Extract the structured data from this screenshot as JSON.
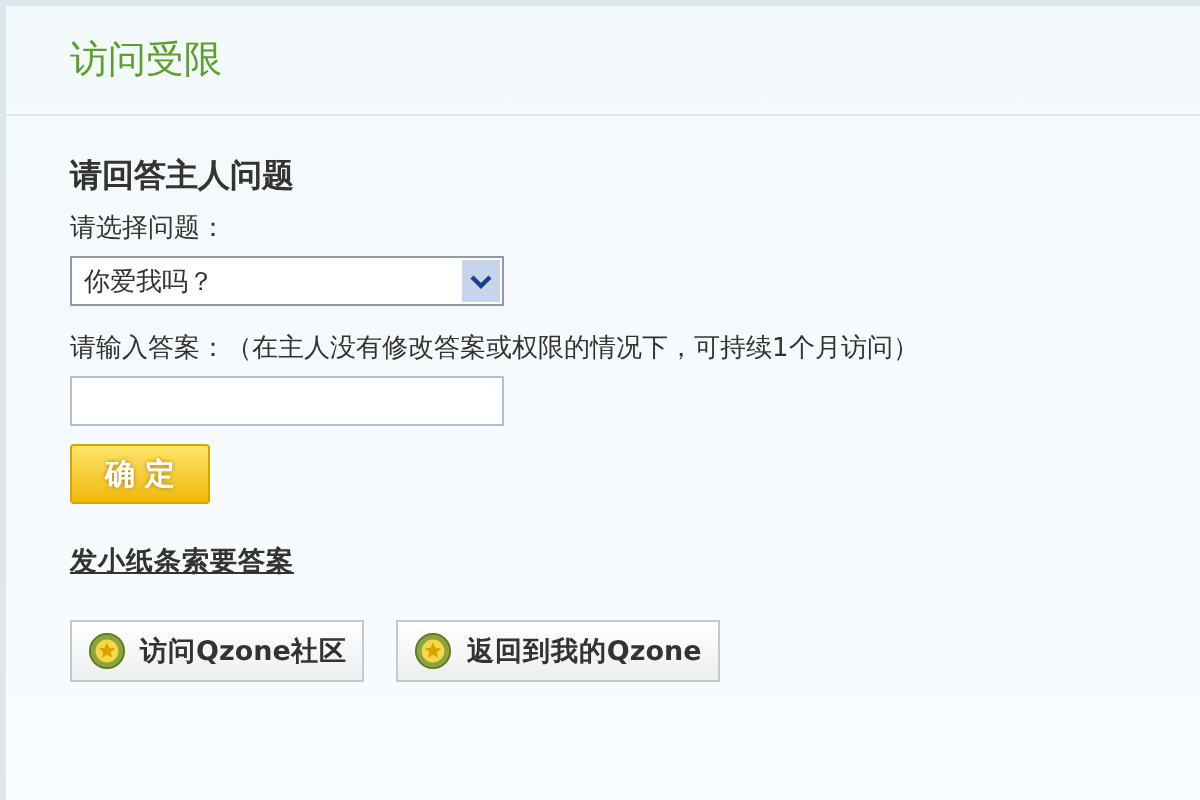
{
  "page": {
    "title": "访问受限"
  },
  "form": {
    "heading": "请回答主人问题",
    "question_label": "请选择问题：",
    "question_select": {
      "value": "你爱我吗？"
    },
    "answer_label": "请输入答案：（在主人没有修改答案或权限的情况下，可持续1个月访问）",
    "submit_button": "确 定"
  },
  "note_link": "发小纸条索要答案",
  "buttons": [
    {
      "label": "访问Qzone社区"
    },
    {
      "label": "返回到我的Qzone"
    }
  ]
}
